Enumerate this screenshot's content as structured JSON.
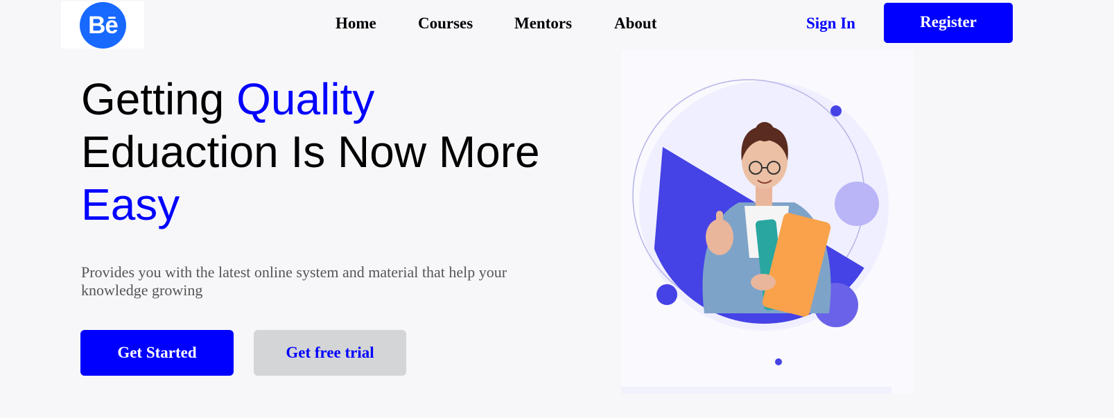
{
  "brand": {
    "logo_text": "Bē",
    "accent": "#0000ff",
    "logo_color": "#1769ff"
  },
  "nav": {
    "items": [
      {
        "label": "Home"
      },
      {
        "label": "Courses"
      },
      {
        "label": "Mentors"
      },
      {
        "label": "About"
      }
    ],
    "sign_in": "Sign In",
    "register": "Register"
  },
  "hero": {
    "headline_part1": "Getting ",
    "headline_highlight1": "Quality",
    "headline_part2": "Eduaction Is Now More",
    "headline_highlight2": "Easy",
    "subtext": "Provides you with the latest online system and material that help your knowledge growing",
    "primary_button": "Get Started",
    "secondary_button": "Get free trial",
    "illustration": "student-with-books-illustration"
  }
}
